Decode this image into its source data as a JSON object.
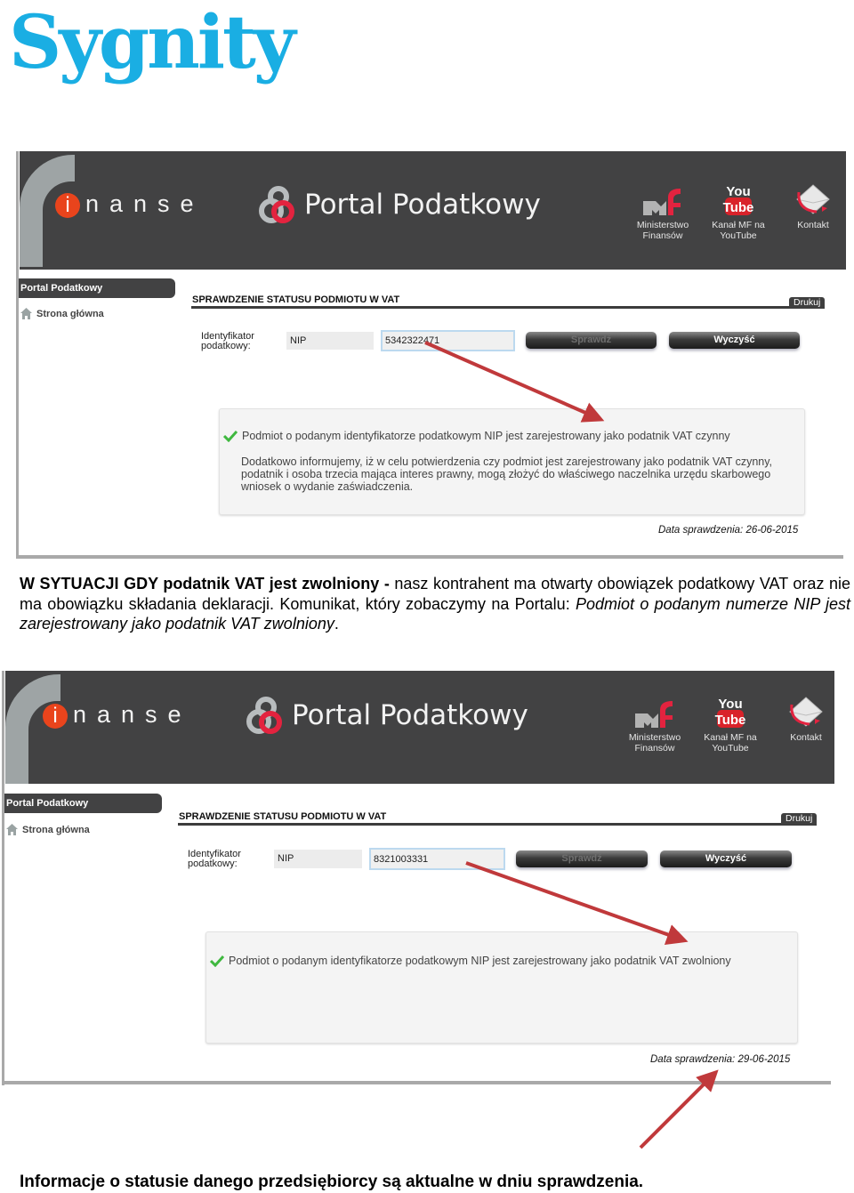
{
  "logo": {
    "text": "Sygnity",
    "color": "#1aaee3"
  },
  "screenshots": [
    {
      "banner": {
        "brand_letter": "i",
        "brand_rest": "nanse",
        "portal_title": "Portal Podatkowy",
        "nav_links": [
          {
            "icon": "mf-logo-icon",
            "label_line1": "Ministerstwo",
            "label_line2": "Finansów"
          },
          {
            "icon": "youtube-icon",
            "label_line1": "Kanał MF na",
            "label_line2": "YouTube"
          },
          {
            "icon": "envelope-icon",
            "label_line1": "Kontakt",
            "label_line2": ""
          }
        ]
      },
      "sidebar": {
        "header": "Portal Podatkowy",
        "items": [
          {
            "icon": "house-icon",
            "label": "Strona główna"
          }
        ]
      },
      "main": {
        "section_title": "SPRAWDZENIE STATUSU PODMIOTU W VAT",
        "print_label": "Drukuj",
        "field_label_line1": "Identyfikator",
        "field_label_line2": "podatkowy:",
        "id_type": "NIP",
        "nip_value": "5342322471",
        "check_button": "Sprawdź",
        "clear_button": "Wyczyść",
        "result_message": "Podmiot o podanym identyfikatorze podatkowym NIP jest zarejestrowany jako podatnik VAT czynny",
        "result_note": "Dodatkowo informujemy, iż w celu potwierdzenia czy podmiot jest zarejestrowany jako podatnik VAT czynny, podatnik i osoba trzecia mająca interes prawny, mogą złożyć do właściwego naczelnika urzędu skarbowego wniosek o wydanie zaświadczenia.",
        "check_date": "Data sprawdzenia: 26-06-2015"
      }
    },
    {
      "banner": {
        "brand_letter": "i",
        "brand_rest": "nanse",
        "portal_title": "Portal Podatkowy",
        "nav_links": [
          {
            "icon": "mf-logo-icon",
            "label_line1": "Ministerstwo",
            "label_line2": "Finansów"
          },
          {
            "icon": "youtube-icon",
            "label_line1": "Kanał MF na",
            "label_line2": "YouTube"
          },
          {
            "icon": "envelope-icon",
            "label_line1": "Kontakt",
            "label_line2": ""
          }
        ]
      },
      "sidebar": {
        "header": "Portal Podatkowy",
        "items": [
          {
            "icon": "house-icon",
            "label": "Strona główna"
          }
        ]
      },
      "main": {
        "section_title": "SPRAWDZENIE STATUSU PODMIOTU W VAT",
        "print_label": "Drukuj",
        "field_label_line1": "Identyfikator",
        "field_label_line2": "podatkowy:",
        "id_type": "NIP",
        "nip_value": "8321003331",
        "check_button": "Sprawdź",
        "clear_button": "Wyczyść",
        "result_message": "Podmiot o podanym identyfikatorze podatkowym NIP jest zarejestrowany jako podatnik VAT zwolniony",
        "check_date": "Data sprawdzenia: 29-06-2015"
      }
    }
  ],
  "paragraph": {
    "bold_lead": "W SYTUACJI GDY podatnik VAT jest zwolniony -",
    "body": " nasz kontrahent ma otwarty obowiązek podatkowy VAT oraz nie ma obowiązku składania deklaracji. Komunikat, który zobaczymy na Portalu: ",
    "italic_quote": "Podmiot o podanym numerze NIP jest zarejestrowany jako podatnik VAT zwolniony",
    "end": "."
  },
  "footer_note": "Informacje o statusie danego przedsiębiorcy są aktualne w dniu sprawdzenia.",
  "colors": {
    "banner": "#424243",
    "accent_red": "#e9441c",
    "arrow": "#c0393b",
    "check_green": "#3fb83f"
  }
}
